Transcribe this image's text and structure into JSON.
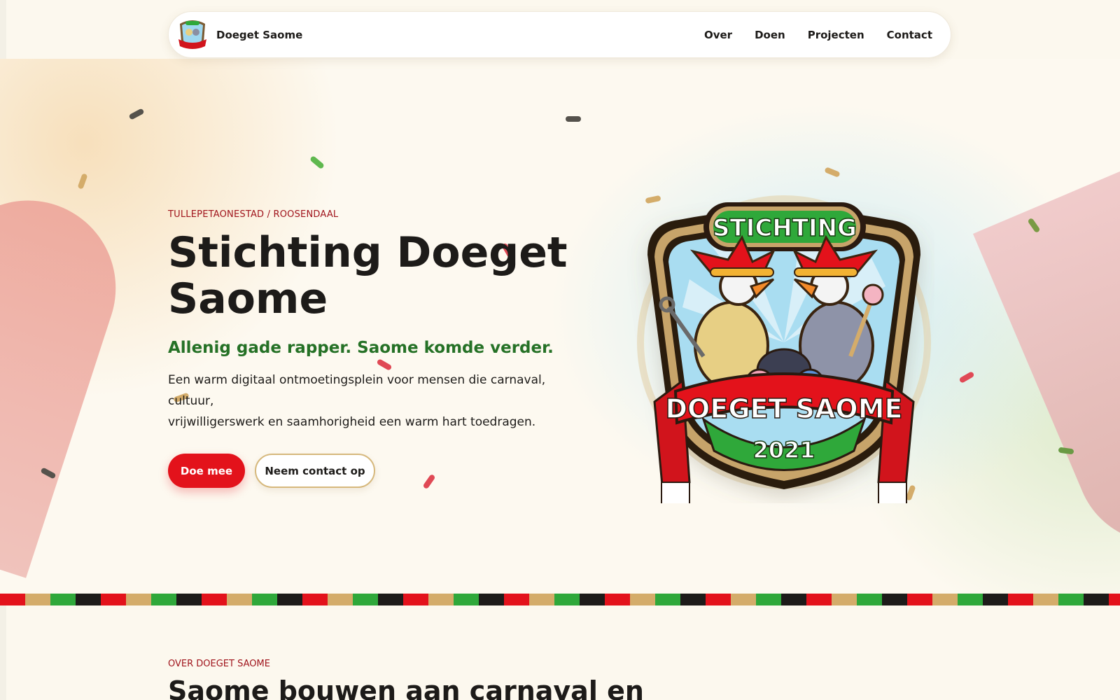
{
  "header": {
    "brand_name": "Doeget Saome",
    "nav": [
      {
        "label": "Over"
      },
      {
        "label": "Doen"
      },
      {
        "label": "Projecten"
      },
      {
        "label": "Contact"
      }
    ]
  },
  "hero": {
    "eyebrow": "TULLEPETAONESTAD / ROOSENDAAL",
    "title_line1": "Stichting Doeget",
    "title_line2": "Saome",
    "subtitle": "Allenig gade rapper. Saome komde verder.",
    "description_line1": "Een warm digitaal ontmoetingsplein voor mensen die carnaval, cultuur,",
    "description_line2": "vrijwilligerswerk en saamhorigheid een warm hart toedragen.",
    "primary_button": "Doe mee",
    "secondary_button": "Neem contact op"
  },
  "badge": {
    "top_text": "STICHTING",
    "banner_text": "DOEGET SAOME",
    "year": "2021"
  },
  "about": {
    "eyebrow": "OVER DOEGET SAOME",
    "title": "Saome bouwen aan carnaval en"
  },
  "colors": {
    "accent_red": "#e3121b",
    "accent_green": "#257126",
    "eyebrow_red": "#a0141c",
    "gold": "#d6b87c",
    "stripe": [
      "#e3121b",
      "#d4ac6a",
      "#2fa83a",
      "#1d1b19"
    ]
  }
}
